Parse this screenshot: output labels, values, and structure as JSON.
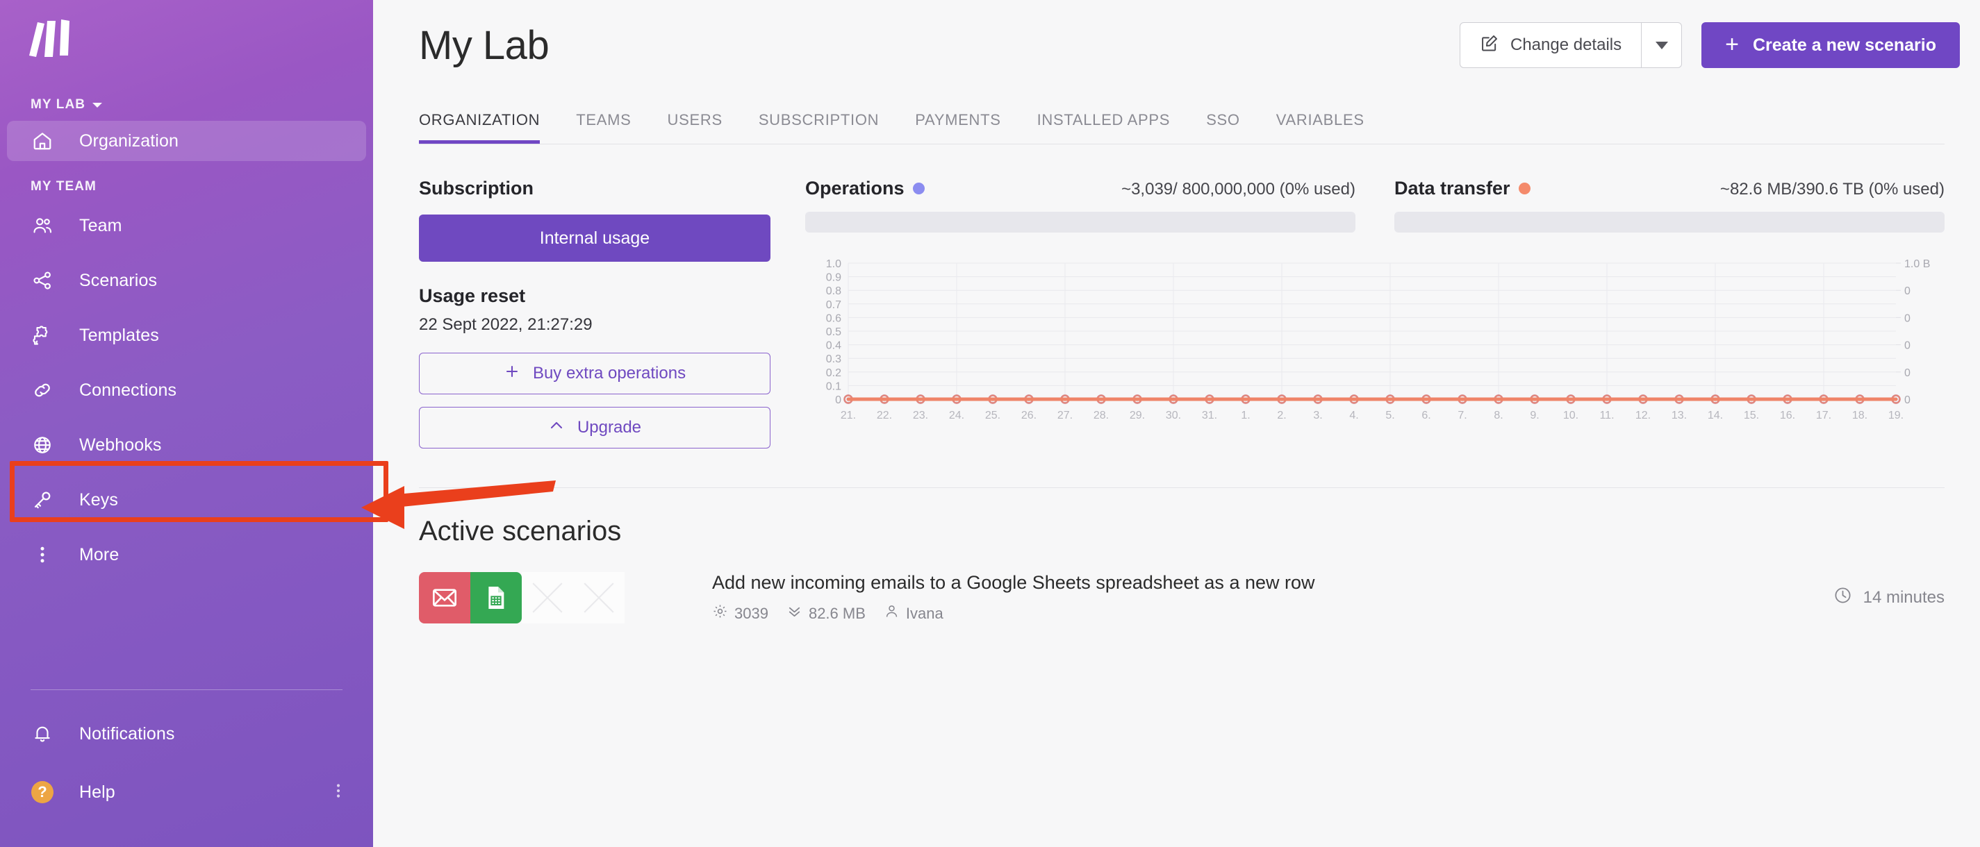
{
  "sidebar": {
    "logo_name": "make-logo",
    "org_label": "MY LAB",
    "team_label": "MY TEAM",
    "org_item": {
      "label": "Organization",
      "icon": "home-icon"
    },
    "items": [
      {
        "label": "Team",
        "icon": "people-icon"
      },
      {
        "label": "Scenarios",
        "icon": "share-nodes-icon"
      },
      {
        "label": "Templates",
        "icon": "puzzle-icon"
      },
      {
        "label": "Connections",
        "icon": "link-icon"
      },
      {
        "label": "Webhooks",
        "icon": "globe-icon"
      },
      {
        "label": "Keys",
        "icon": "key-icon"
      },
      {
        "label": "More",
        "icon": "kebab-icon"
      }
    ],
    "bottom_items": [
      {
        "label": "Notifications",
        "icon": "bell-icon"
      },
      {
        "label": "Help",
        "icon": "question-circle-icon"
      }
    ]
  },
  "header": {
    "title": "My Lab",
    "change_details_label": "Change details",
    "change_details_icon": "edit-pencil-icon",
    "dropdown_icon": "chevron-down-icon",
    "create_scenario_label": "Create a new scenario",
    "create_scenario_icon": "plus-icon"
  },
  "tabs": [
    {
      "label": "ORGANIZATION",
      "active": true
    },
    {
      "label": "TEAMS",
      "active": false
    },
    {
      "label": "USERS",
      "active": false
    },
    {
      "label": "SUBSCRIPTION",
      "active": false
    },
    {
      "label": "PAYMENTS",
      "active": false
    },
    {
      "label": "INSTALLED APPS",
      "active": false
    },
    {
      "label": "SSO",
      "active": false
    },
    {
      "label": "VARIABLES",
      "active": false
    }
  ],
  "subscription": {
    "heading": "Subscription",
    "plan_badge": "Internal usage",
    "usage_reset_heading": "Usage reset",
    "usage_reset_date": "22 Sept 2022, 21:27:29",
    "buy_label": "Buy extra operations",
    "buy_icon": "plus-icon",
    "upgrade_label": "Upgrade",
    "upgrade_icon": "chevron-up-icon"
  },
  "meters": [
    {
      "title": "Operations",
      "dot_color": "#8b8cf0",
      "value": "~3,039/ 800,000,000 (0% used)",
      "percent": 0
    },
    {
      "title": "Data transfer",
      "dot_color": "#f48a6b",
      "value": "~82.6 MB/390.6 TB (0% used)",
      "percent": 0
    }
  ],
  "chart_data": {
    "type": "line",
    "title": "",
    "xlabel": "",
    "ylabel": "",
    "grid": true,
    "legend": "none",
    "x": [
      "21.",
      "22.",
      "23.",
      "24.",
      "25.",
      "26.",
      "27.",
      "28.",
      "29.",
      "30.",
      "31.",
      "1.",
      "2.",
      "3.",
      "4.",
      "5.",
      "6.",
      "7.",
      "8.",
      "9.",
      "10.",
      "11.",
      "12.",
      "13.",
      "14.",
      "15.",
      "16.",
      "17.",
      "18.",
      "19."
    ],
    "left_axis": {
      "ticks": [
        "1.0",
        "0.9",
        "0.8",
        "0.7",
        "0.6",
        "0.5",
        "0.4",
        "0.3",
        "0.2",
        "0.1",
        "0"
      ],
      "ylim": [
        0,
        1
      ]
    },
    "right_axis": {
      "ticks": [
        "1.0 B",
        "0",
        "0",
        "0",
        "0",
        "0"
      ],
      "ylim": [
        0,
        1
      ]
    },
    "series": [
      {
        "name": "Operations",
        "color": "#8b8cf0",
        "values": [
          0,
          0,
          0,
          0,
          0,
          0,
          0,
          0,
          0,
          0,
          0,
          0,
          0,
          0,
          0,
          0,
          0,
          0,
          0,
          0,
          0,
          0,
          0,
          0,
          0,
          0,
          0,
          0,
          0,
          0
        ]
      },
      {
        "name": "Data transfer",
        "color": "#ef8468",
        "values": [
          0,
          0,
          0,
          0,
          0,
          0,
          0,
          0,
          0,
          0,
          0,
          0,
          0,
          0,
          0,
          0,
          0,
          0,
          0,
          0,
          0,
          0,
          0,
          0,
          0,
          0,
          0,
          0,
          0,
          0
        ]
      }
    ]
  },
  "active_scenarios": {
    "heading": "Active scenarios",
    "rows": [
      {
        "name": "Add new incoming emails to a Google Sheets spreadsheet as a new row",
        "operations": "3039",
        "operations_icon": "gear-icon",
        "transfer": "82.6 MB",
        "transfer_icon": "double-chevron-down-icon",
        "owner": "Ivana",
        "owner_icon": "user-icon",
        "interval": "14 minutes",
        "interval_icon": "clock-icon",
        "apps": [
          "email-icon",
          "google-sheets-icon",
          "placeholder-x",
          "placeholder-x"
        ]
      }
    ]
  },
  "annotation": {
    "highlight_target": "Webhooks",
    "color": "#ea3f1c"
  }
}
